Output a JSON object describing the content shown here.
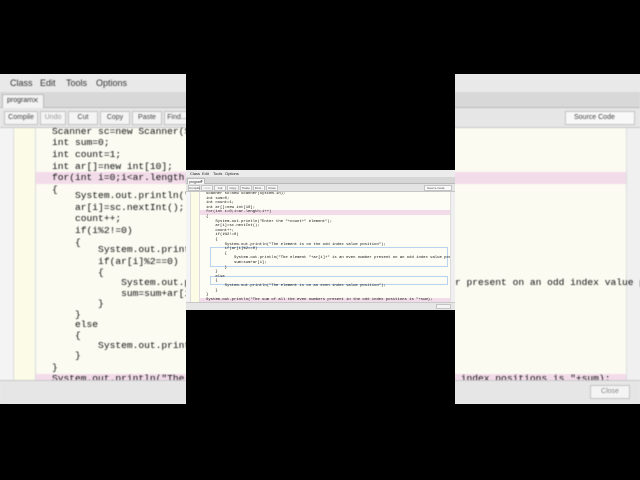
{
  "menu": [
    "Class",
    "Edit",
    "Tools",
    "Options"
  ],
  "tab": {
    "label": "program",
    "close": "✕"
  },
  "toolbar": {
    "buttons": [
      "Compile",
      "Undo",
      "Cut",
      "Copy",
      "Paste",
      "Find...",
      "Close"
    ],
    "source_select": "Source Code"
  },
  "footer_button": "Close",
  "code_lines": [
    "Scanner sc=new Scanner(System.in);",
    "int sum=0;",
    "int count=1;",
    "int ar[]=new int[10];",
    "for(int i=0;i<ar.length;i++)",
    "{",
    "    System.out.println(\"Enter the \"+count+\" element\");",
    "    ar[i]=sc.nextInt();",
    "    count++;",
    "    if(i%2!=0)",
    "    {",
    "        System.out.println(\"The element is on the odd index value position\");",
    "        if(ar[i]%2==0)",
    "        {",
    "            System.out.println(\"The element \"+ar[i]+\" is an even number present on an odd index value position\");",
    "            sum=sum+ar[i];",
    "        }",
    "    }",
    "    else",
    "    {",
    "        System.out.println(\"The element is on an even index value position\");",
    "    }",
    "}",
    "System.out.println(\"The sum of all the even numbers present in the odd index positions is \"+sum);"
  ],
  "colors": {
    "highlight": "#f3dcea",
    "editor_bg": "#fdfdf6",
    "window_bg": "#f0f0f0"
  }
}
